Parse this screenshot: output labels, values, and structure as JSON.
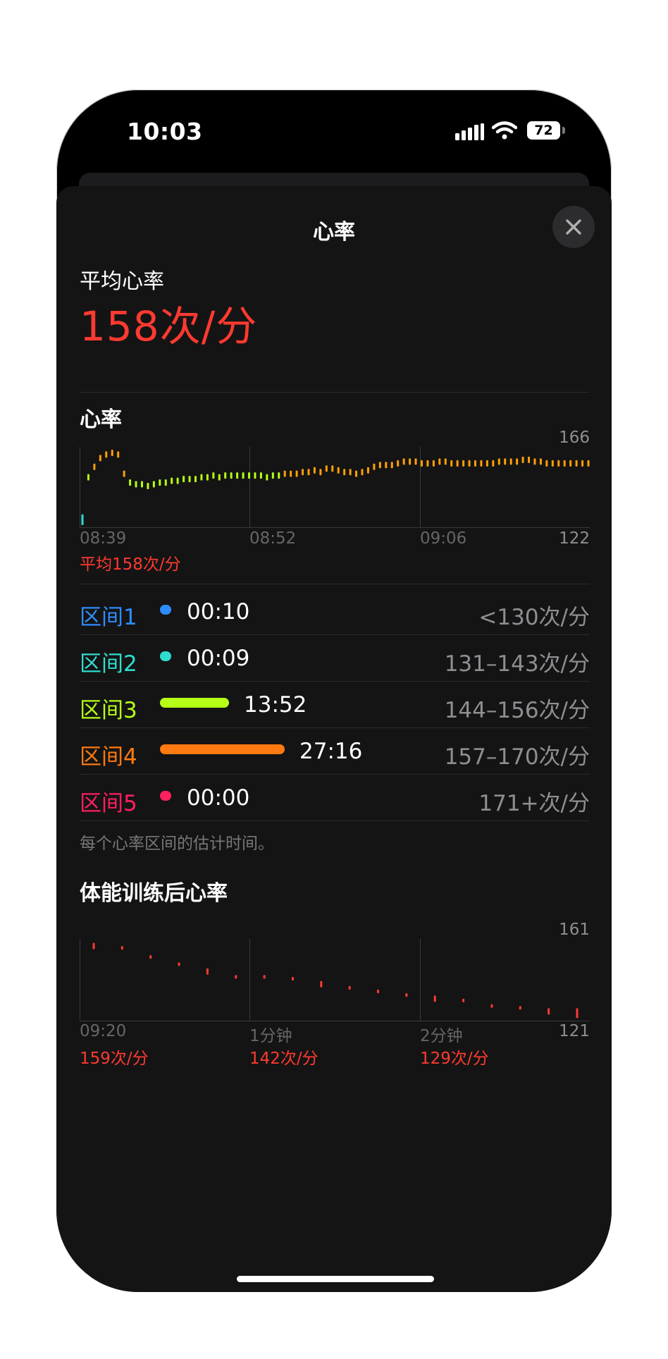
{
  "status_bar": {
    "time": "10:03",
    "battery": "72"
  },
  "sheet": {
    "title": "心率"
  },
  "average": {
    "label": "平均心率",
    "value": "158次/分"
  },
  "hr_chart": {
    "title": "心率",
    "max_label": "166",
    "min_label": "122",
    "x_labels": [
      "08:39",
      "08:52",
      "09:06"
    ],
    "avg_note": "平均158次/分"
  },
  "zones": [
    {
      "name": "区间1",
      "duration": "00:10",
      "range": "<130次/分",
      "color": "#2f8cff"
    },
    {
      "name": "区间2",
      "duration": "00:09",
      "range": "131–143次/分",
      "color": "#2fdcd0"
    },
    {
      "name": "区间3",
      "duration": "13:52",
      "range": "144–156次/分",
      "color": "#b6ff16"
    },
    {
      "name": "区间4",
      "duration": "27:16",
      "range": "157–170次/分",
      "color": "#ff7a10"
    },
    {
      "name": "区间5",
      "duration": "00:00",
      "range": "171+次/分",
      "color": "#ff1f5f"
    }
  ],
  "zones_note": "每个心率区间的估计时间。",
  "recovery_chart": {
    "title": "体能训练后心率",
    "max_label": "161",
    "min_label": "121",
    "x_labels": [
      "09:20",
      "1分钟",
      "2分钟"
    ],
    "values_text": [
      "159次/分",
      "142次/分",
      "129次/分"
    ]
  },
  "chart_data": [
    {
      "type": "bar",
      "title": "心率",
      "ylim": [
        122,
        166
      ],
      "x_ticks": [
        "08:39",
        "08:52",
        "09:06"
      ],
      "values": [
        127,
        150,
        156,
        161,
        163,
        164,
        163,
        152,
        147,
        146,
        146,
        145,
        146,
        147,
        147,
        148,
        148,
        149,
        149,
        149,
        150,
        150,
        151,
        150,
        151,
        151,
        151,
        151,
        151,
        151,
        151,
        150,
        151,
        151,
        152,
        152,
        152,
        153,
        153,
        154,
        153,
        155,
        155,
        154,
        153,
        153,
        152,
        153,
        154,
        156,
        157,
        157,
        157,
        158,
        159,
        159,
        159,
        158,
        158,
        158,
        159,
        159,
        158,
        158,
        158,
        158,
        158,
        158,
        158,
        158,
        159,
        159,
        159,
        159,
        160,
        160,
        159,
        159,
        158,
        158,
        158,
        158,
        158,
        158,
        158,
        158
      ],
      "colors": {
        "low": "#2fdcd0",
        "mid": "#b6ff16",
        "high": "#ff9f0a"
      }
    },
    {
      "type": "bar",
      "title": "体能训练后心率",
      "ylim": [
        121,
        161
      ],
      "x_ticks": [
        "09:20",
        "1分钟",
        "2分钟"
      ],
      "values": [
        159,
        158,
        153,
        149,
        145,
        142,
        142,
        141,
        138,
        136,
        134,
        132,
        130,
        129,
        126,
        125,
        123,
        122
      ],
      "color": "#ff3a30"
    }
  ]
}
